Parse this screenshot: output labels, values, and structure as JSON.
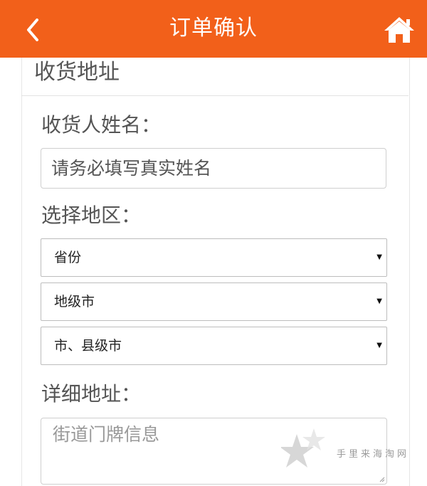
{
  "header": {
    "title": "订单确认",
    "background_color": "#f2601a",
    "back_icon": "chevron-left-icon",
    "home_icon": "home-icon"
  },
  "section": {
    "title": "收货地址"
  },
  "name_field": {
    "label": "收货人姓名：",
    "placeholder": "请务必填写真实姓名"
  },
  "region": {
    "label": "选择地区：",
    "province": "省份",
    "prefecture": "地级市",
    "county": "市、县级市"
  },
  "address": {
    "label": "详细地址：",
    "placeholder": "街道门牌信息"
  },
  "watermark": {
    "text": "手里来海淘网"
  }
}
